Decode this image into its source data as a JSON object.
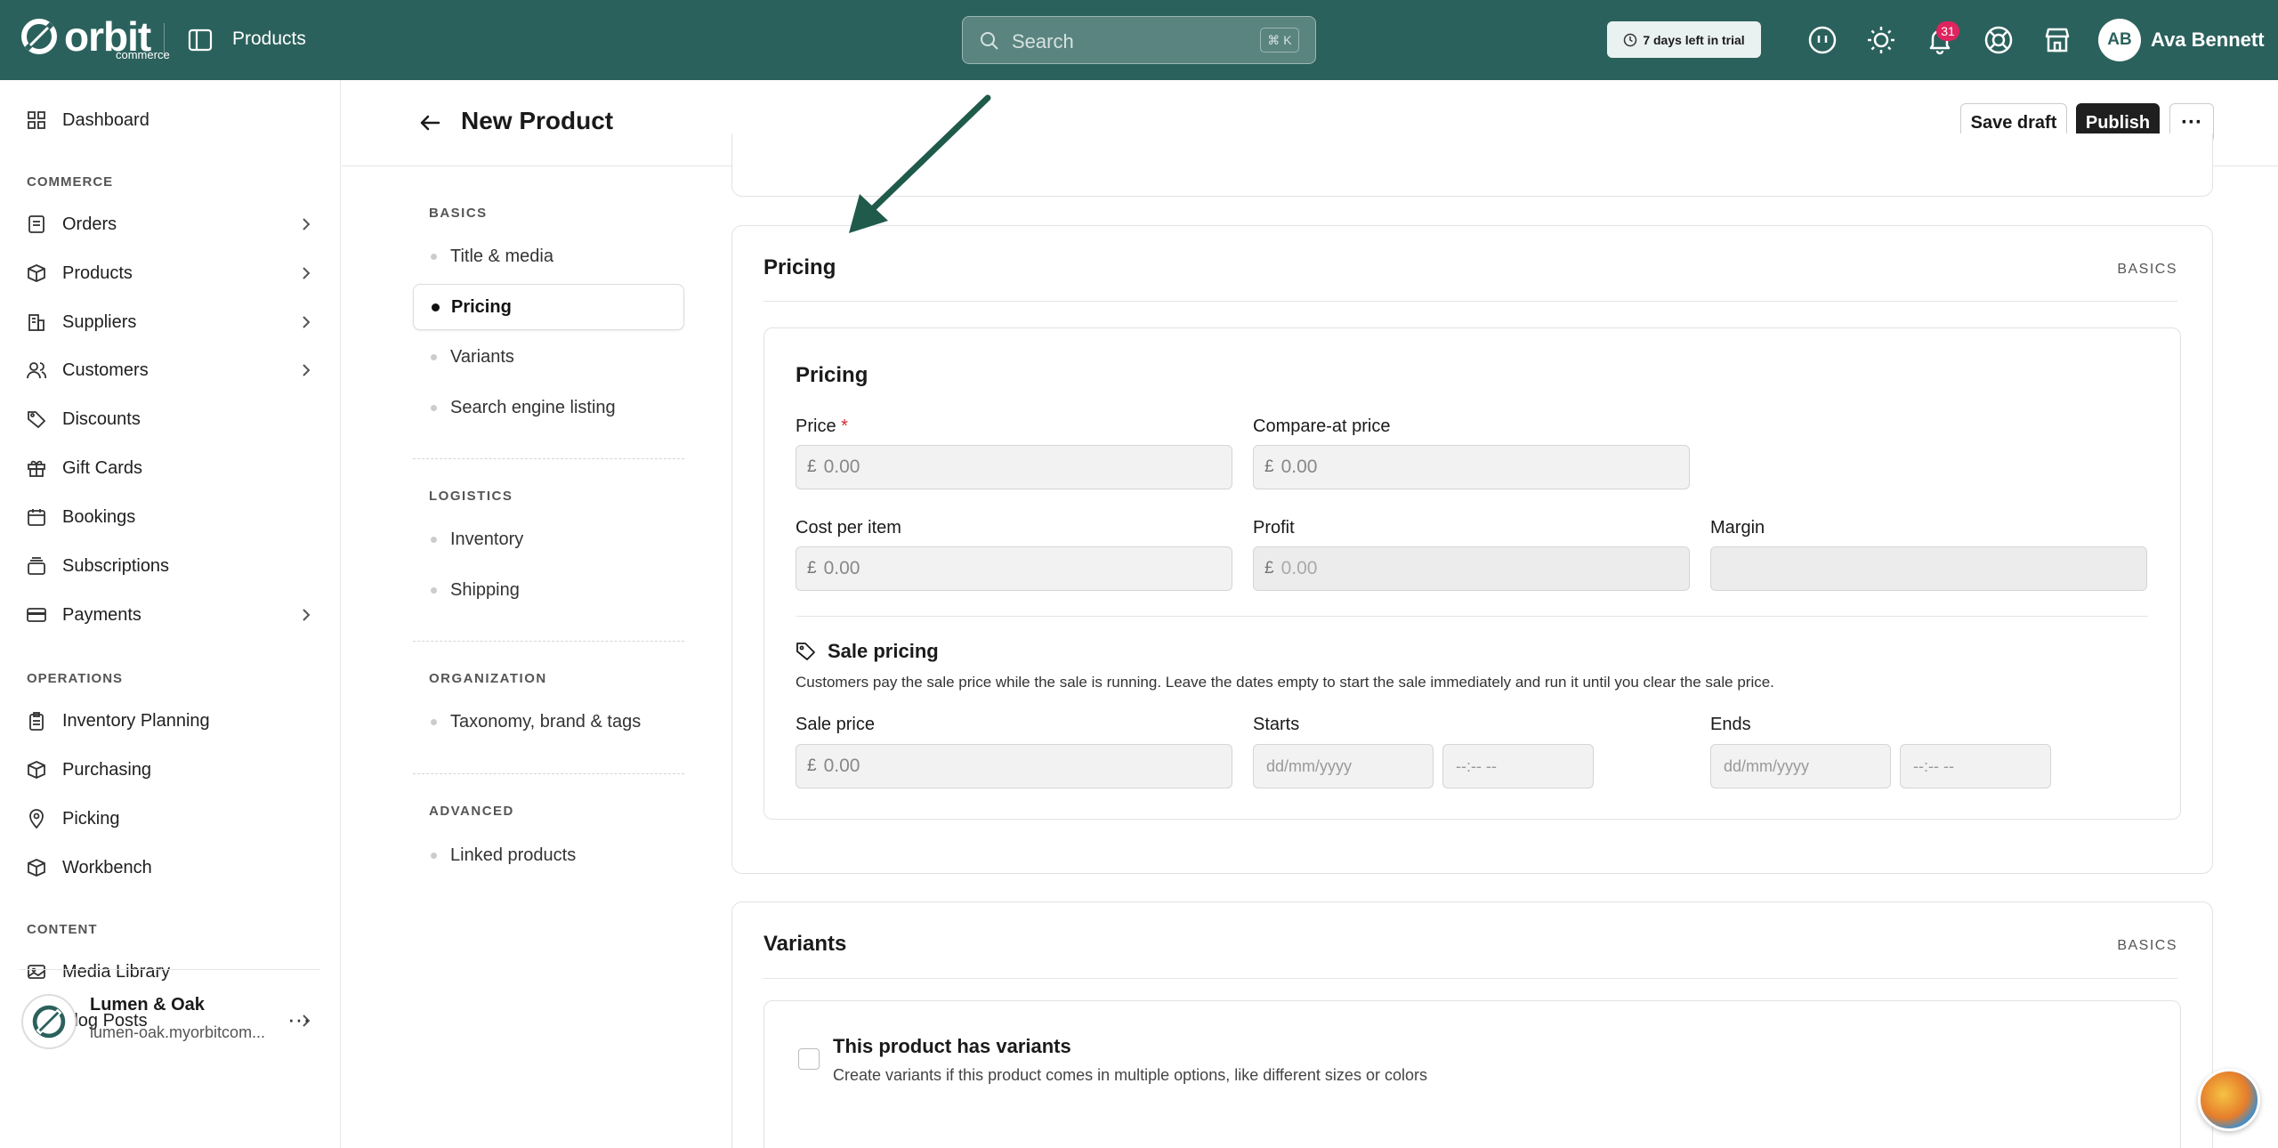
{
  "topbar": {
    "logo_word": "orbit",
    "logo_sub": "commerce",
    "breadcrumb": "Products",
    "search_placeholder": "Search",
    "search_shortcut": "⌘ K",
    "trial_label": "7 days left in trial",
    "notification_count": "31",
    "avatar_initials": "AB",
    "user_name": "Ava Bennett",
    "brand_color": "#2b615c"
  },
  "sidebar": {
    "dashboard": "Dashboard",
    "commerce_label": "COMMERCE",
    "commerce_items": [
      "Orders",
      "Products",
      "Suppliers",
      "Customers",
      "Discounts",
      "Gift Cards",
      "Bookings",
      "Subscriptions",
      "Payments"
    ],
    "operations_label": "OPERATIONS",
    "operations_items": [
      "Inventory Planning",
      "Purchasing",
      "Picking",
      "Workbench"
    ],
    "content_label": "CONTENT",
    "content_items": [
      "Media Library",
      "Blog Posts"
    ],
    "store_name": "Lumen & Oak",
    "store_url": "lumen-oak.myorbitcom...",
    "store_more": "···"
  },
  "header": {
    "title": "New Product",
    "save_draft": "Save draft",
    "publish": "Publish",
    "more": "···"
  },
  "subnav": {
    "basics_label": "BASICS",
    "basics_items": [
      "Title & media",
      "Pricing",
      "Variants",
      "Search engine listing"
    ],
    "active_item": "Pricing",
    "logistics_label": "LOGISTICS",
    "logistics_items": [
      "Inventory",
      "Shipping"
    ],
    "organization_label": "ORGANIZATION",
    "organization_items": [
      "Taxonomy, brand & tags"
    ],
    "advanced_label": "ADVANCED",
    "advanced_items": [
      "Linked products"
    ]
  },
  "pricing_card": {
    "title": "Pricing",
    "tag": "BASICS",
    "inner_title": "Pricing",
    "price_label": "Price",
    "required_mark": "*",
    "compare_label": "Compare-at price",
    "cost_label": "Cost per item",
    "profit_label": "Profit",
    "margin_label": "Margin",
    "currency": "£",
    "price_placeholder": "0.00",
    "compare_placeholder": "0.00",
    "cost_placeholder": "0.00",
    "profit_placeholder": "0.00",
    "sale_title": "Sale pricing",
    "sale_desc": "Customers pay the sale price while the sale is running. Leave the dates empty to start the sale immediately and run it until you clear the sale price.",
    "sale_price_label": "Sale price",
    "sale_price_placeholder": "0.00",
    "starts_label": "Starts",
    "ends_label": "Ends",
    "date_placeholder": "dd/mm/yyyy",
    "time_placeholder": "--:-- --"
  },
  "variants_card": {
    "title": "Variants",
    "tag": "BASICS",
    "checkbox_label": "This product has variants",
    "checkbox_desc": "Create variants if this product comes in multiple options, like different sizes or colors",
    "checked": false
  }
}
